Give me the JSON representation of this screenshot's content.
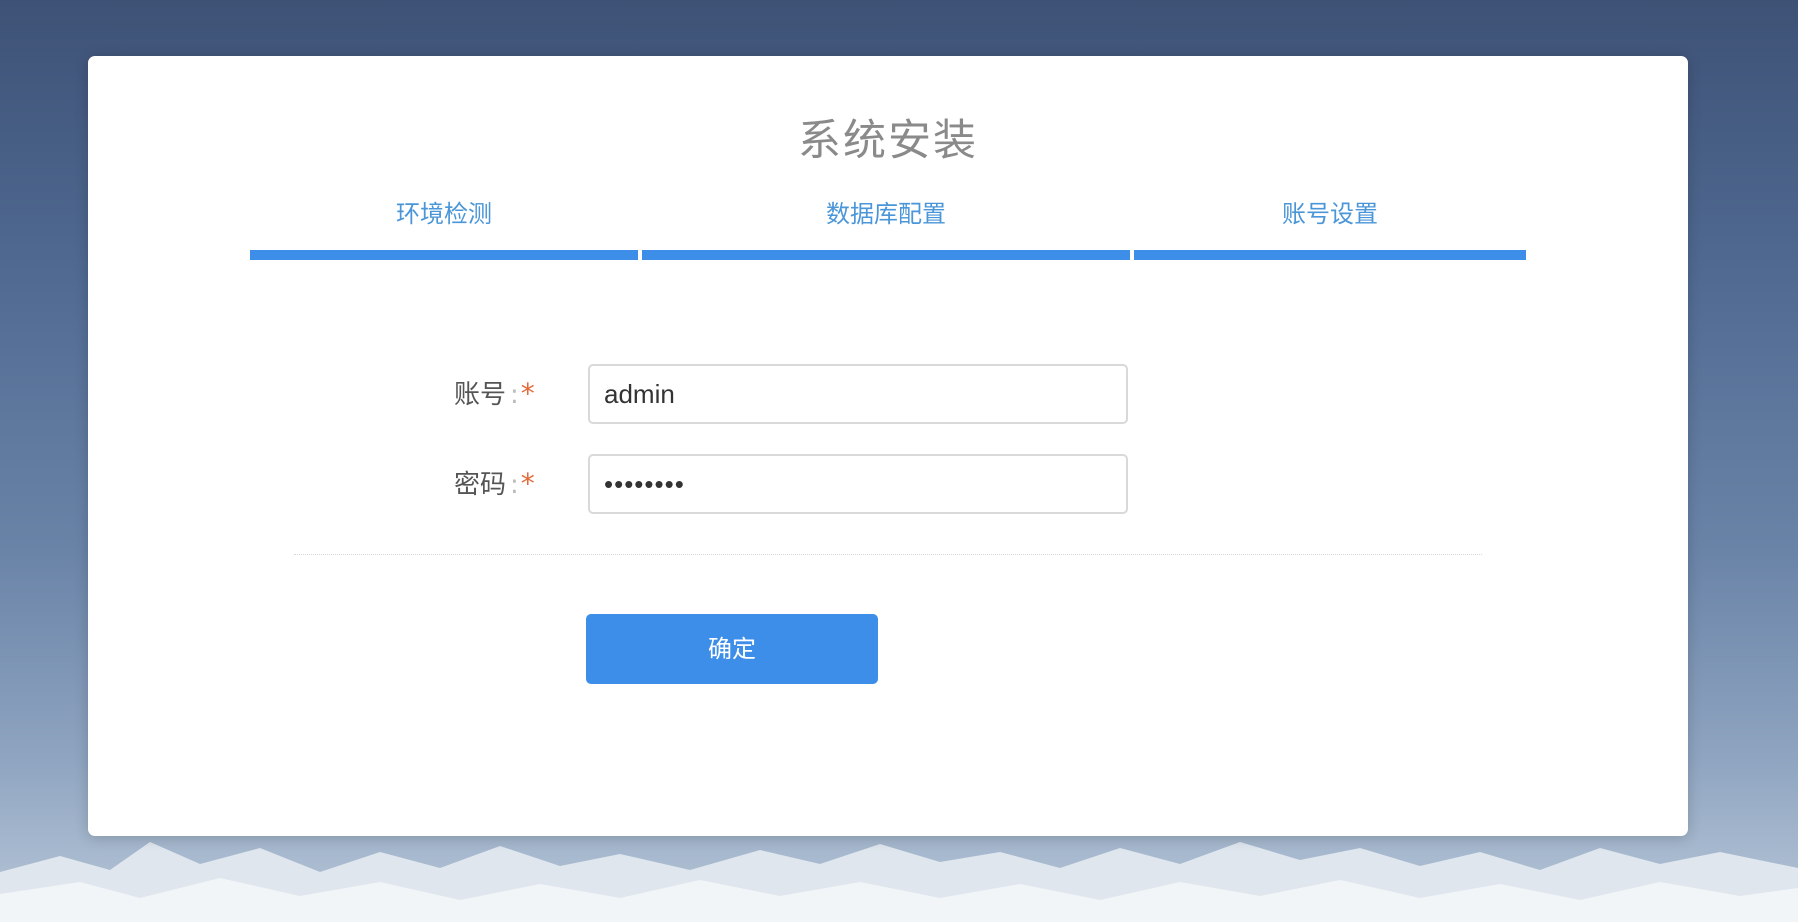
{
  "page": {
    "title": "系统安装"
  },
  "steps": [
    {
      "label": "环境检测"
    },
    {
      "label": "数据库配置"
    },
    {
      "label": "账号设置"
    }
  ],
  "form": {
    "account": {
      "label": "账号",
      "colon": ":",
      "required_mark": "*",
      "value": "admin"
    },
    "password": {
      "label": "密码",
      "colon": ":",
      "required_mark": "*",
      "value": "••••••••"
    }
  },
  "submit": {
    "label": "确定"
  },
  "colors": {
    "accent": "#3d8ee8",
    "step_text": "#4a96d8",
    "required": "#e46a3a"
  }
}
